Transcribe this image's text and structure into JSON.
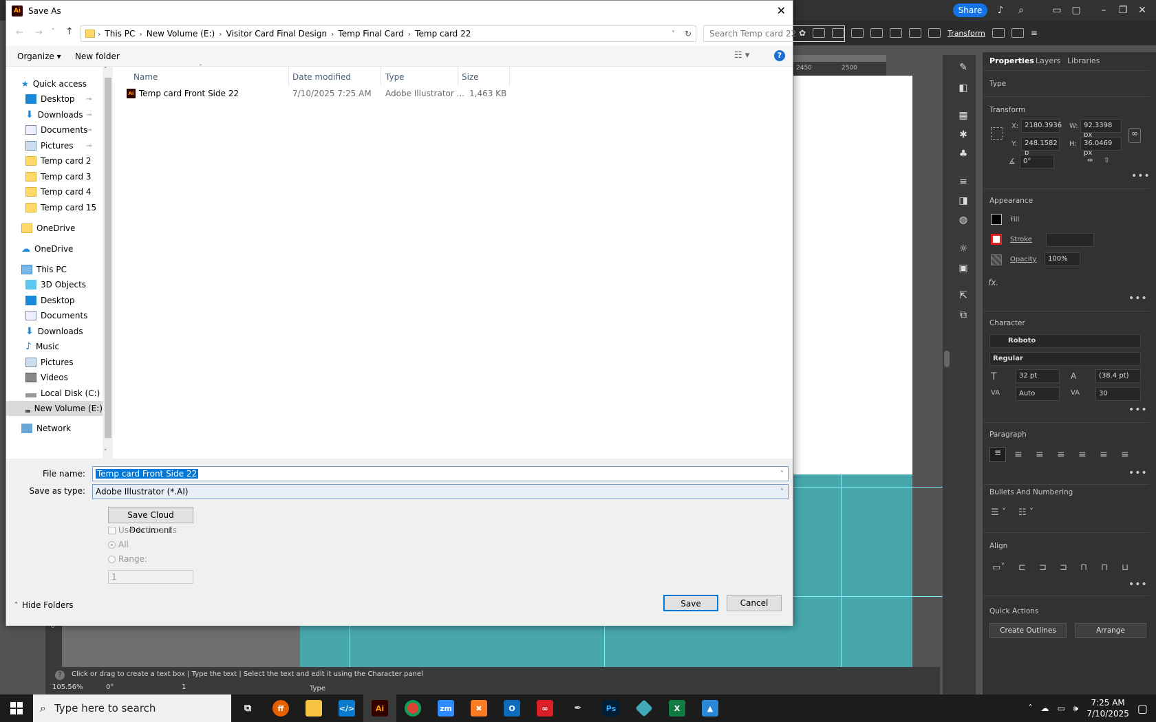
{
  "illustrator": {
    "share_label": "Share",
    "transform_label": "Transform",
    "ruler_marks": [
      "2450",
      "2500"
    ],
    "panel_tabs": [
      "Properties",
      "Layers",
      "Libraries"
    ],
    "type_label": "Type",
    "transform_section": "Transform",
    "x_label": "X:",
    "x_value": "2180.3936",
    "y_label": "Y:",
    "y_value": "248.1582 p",
    "w_label": "W:",
    "w_value": "92.3398 px",
    "h_label": "H:",
    "h_value": "36.0469 px",
    "angle_value": "0°",
    "appearance_section": "Appearance",
    "fill_label": "Fill",
    "stroke_label": "Stroke",
    "opacity_label": "Opacity",
    "opacity_value": "100%",
    "fx_label": "fx.",
    "character_section": "Character",
    "font_family": "Roboto",
    "font_style": "Regular",
    "font_size": "32 pt",
    "leading": "(38.4 pt)",
    "kerning": "Auto",
    "tracking": "30",
    "paragraph_section": "Paragraph",
    "bullets_section": "Bullets And Numbering",
    "align_section": "Align",
    "quick_actions_section": "Quick Actions",
    "create_outlines_label": "Create Outlines",
    "arrange_label": "Arrange",
    "status_hint": "Click or drag to create a text box  |  Type the text  |  Select the text and edit it using the Character panel",
    "zoom_value": "105.56%",
    "rotate_value": "0°",
    "artboard_value": "1",
    "status_type": "Type",
    "ruler_left_mark": "0"
  },
  "dialog": {
    "title": "Save As",
    "breadcrumbs": [
      "This PC",
      "New Volume (E:)",
      "Visitor Card Final Design",
      "Temp Final Card",
      "Temp  card 22"
    ],
    "search_placeholder": "Search Temp  card 22",
    "organize_label": "Organize",
    "new_folder_label": "New folder",
    "nav_items": [
      {
        "label": "Quick access",
        "icon": "star-icon"
      },
      {
        "label": "Desktop",
        "icon": "desktop-icon"
      },
      {
        "label": "Downloads",
        "icon": "download-icon"
      },
      {
        "label": "Documents",
        "icon": "document-icon"
      },
      {
        "label": "Pictures",
        "icon": "pictures-icon"
      },
      {
        "label": "Temp  card 2",
        "icon": "folder-icon"
      },
      {
        "label": "Temp  card 3",
        "icon": "folder-icon"
      },
      {
        "label": "Temp  card 4",
        "icon": "folder-icon"
      },
      {
        "label": "Temp  card 15",
        "icon": "folder-icon"
      },
      {
        "label": "OneDrive",
        "icon": "folder-icon"
      },
      {
        "label": "OneDrive",
        "icon": "cloud-icon"
      },
      {
        "label": "This PC",
        "icon": "computer-icon"
      },
      {
        "label": "3D Objects",
        "icon": "cube-icon"
      },
      {
        "label": "Desktop",
        "icon": "desktop-icon"
      },
      {
        "label": "Documents",
        "icon": "document-icon"
      },
      {
        "label": "Downloads",
        "icon": "download-icon"
      },
      {
        "label": "Music",
        "icon": "music-icon"
      },
      {
        "label": "Pictures",
        "icon": "pictures-icon"
      },
      {
        "label": "Videos",
        "icon": "video-icon"
      },
      {
        "label": "Local Disk (C:)",
        "icon": "drive-icon"
      },
      {
        "label": "New Volume (E:)",
        "icon": "drive-icon"
      },
      {
        "label": "Network",
        "icon": "network-icon"
      }
    ],
    "columns": [
      "Name",
      "Date modified",
      "Type",
      "Size"
    ],
    "files": [
      {
        "name": "Temp  card Front Side 22",
        "date": "7/10/2025 7:25 AM",
        "type": "Adobe Illustrator ...",
        "size": "1,463 KB"
      }
    ],
    "file_name_label": "File name:",
    "file_name_value": "Temp  card Front Side 22",
    "save_type_label": "Save as type:",
    "save_type_value": "Adobe Illustrator (*.AI)",
    "cloud_button": "Save Cloud Document",
    "use_artboards_label": "Use Artboards",
    "all_label": "All",
    "range_label": "Range:",
    "range_value": "1",
    "hide_folders_label": "Hide Folders",
    "save_label": "Save",
    "cancel_label": "Cancel"
  },
  "taskbar": {
    "search_placeholder": "Type here to search",
    "time": "7:25 AM",
    "date": "7/10/2025"
  }
}
